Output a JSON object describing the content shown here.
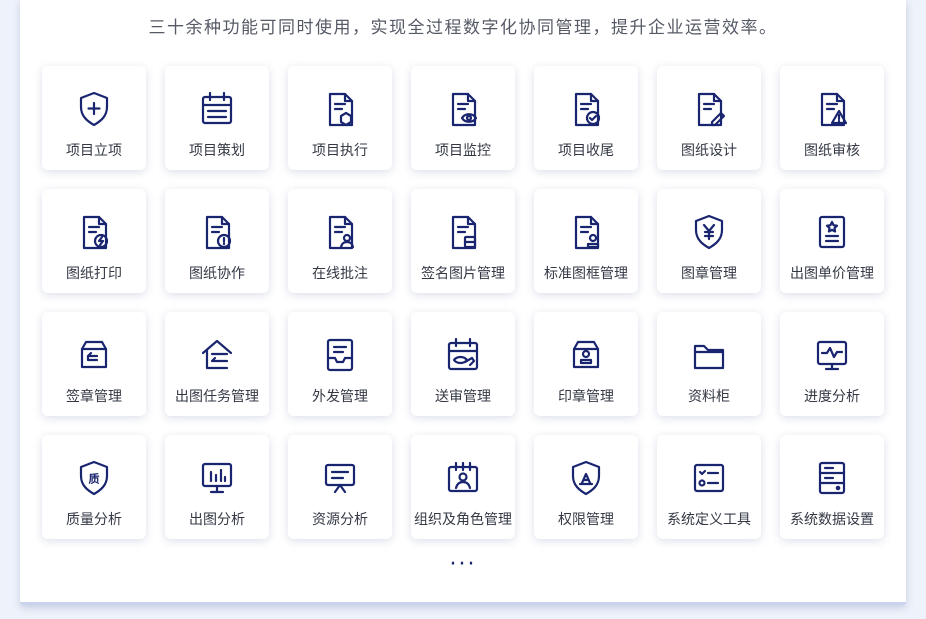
{
  "header": {
    "subtitle": "三十余种功能可同时使用，实现全过程数字化协同管理，提升企业运营效率。"
  },
  "colors": {
    "icon_stroke": "#1a2570",
    "label_text": "#333844",
    "subtitle_text": "#555a66"
  },
  "features": [
    {
      "label": "项目立项",
      "icon": "shield-plus-icon"
    },
    {
      "label": "项目策划",
      "icon": "calendar-lines-icon"
    },
    {
      "label": "项目执行",
      "icon": "document-hexagon-icon"
    },
    {
      "label": "项目监控",
      "icon": "document-eye-icon"
    },
    {
      "label": "项目收尾",
      "icon": "document-check-icon"
    },
    {
      "label": "图纸设计",
      "icon": "document-pencil-icon"
    },
    {
      "label": "图纸审核",
      "icon": "document-warning-icon"
    },
    {
      "label": "图纸打印",
      "icon": "document-lightning-icon"
    },
    {
      "label": "图纸协作",
      "icon": "document-exclamation-icon"
    },
    {
      "label": "在线批注",
      "icon": "document-user-icon"
    },
    {
      "label": "签名图片管理",
      "icon": "document-box-icon"
    },
    {
      "label": "标准图框管理",
      "icon": "document-stamp-icon"
    },
    {
      "label": "图章管理",
      "icon": "shield-yen-icon"
    },
    {
      "label": "出图单价管理",
      "icon": "badge-star-icon"
    },
    {
      "label": "签章管理",
      "icon": "box-arrow-icon"
    },
    {
      "label": "出图任务管理",
      "icon": "house-arrow-icon"
    },
    {
      "label": "外发管理",
      "icon": "tray-document-icon"
    },
    {
      "label": "送审管理",
      "icon": "calendar-eye-icon"
    },
    {
      "label": "印章管理",
      "icon": "box-stamp-icon"
    },
    {
      "label": "资料柜",
      "icon": "folder-icon"
    },
    {
      "label": "进度分析",
      "icon": "monitor-pulse-icon"
    },
    {
      "label": "质量分析",
      "icon": "shield-quality-icon",
      "glyph": "质"
    },
    {
      "label": "出图分析",
      "icon": "monitor-bar-chart-icon"
    },
    {
      "label": "资源分析",
      "icon": "presentation-board-icon"
    },
    {
      "label": "组织及角色管理",
      "icon": "calendar-user-icon"
    },
    {
      "label": "权限管理",
      "icon": "shield-lock-icon"
    },
    {
      "label": "系统定义工具",
      "icon": "checklist-icon"
    },
    {
      "label": "系统数据设置",
      "icon": "server-icon"
    }
  ],
  "footer": {
    "more_label": "···"
  }
}
